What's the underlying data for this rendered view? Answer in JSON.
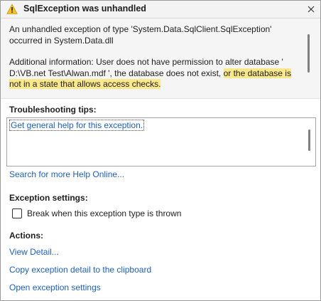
{
  "dialog": {
    "title": "SqlException was unhandled",
    "icon": "warning-icon",
    "close_icon": "close-icon"
  },
  "message": {
    "line1": "An unhandled exception of type 'System.Data.SqlClient.SqlException' occurred in System.Data.dll",
    "additional_plain": "Additional information: User does not have permission to alter database ' D:\\VB.net Test\\Alwan.mdf ', the database does not exist, ",
    "additional_highlighted": "or the database is not in a state that allows access checks.",
    "highlight_color": "#fbe88b"
  },
  "troubleshooting": {
    "heading": "Troubleshooting tips:",
    "tips_link": "Get general help for this exception.",
    "search_link": "Search for more Help Online..."
  },
  "exception_settings": {
    "heading": "Exception settings:",
    "checkbox_label": "Break when this exception type is thrown",
    "checked": false
  },
  "actions": {
    "heading": "Actions:",
    "view_detail": "View Detail...",
    "copy_detail": "Copy exception detail to the clipboard",
    "open_settings": "Open exception settings"
  },
  "colors": {
    "link": "#1f5fb8",
    "warning": "#f5c21b"
  }
}
